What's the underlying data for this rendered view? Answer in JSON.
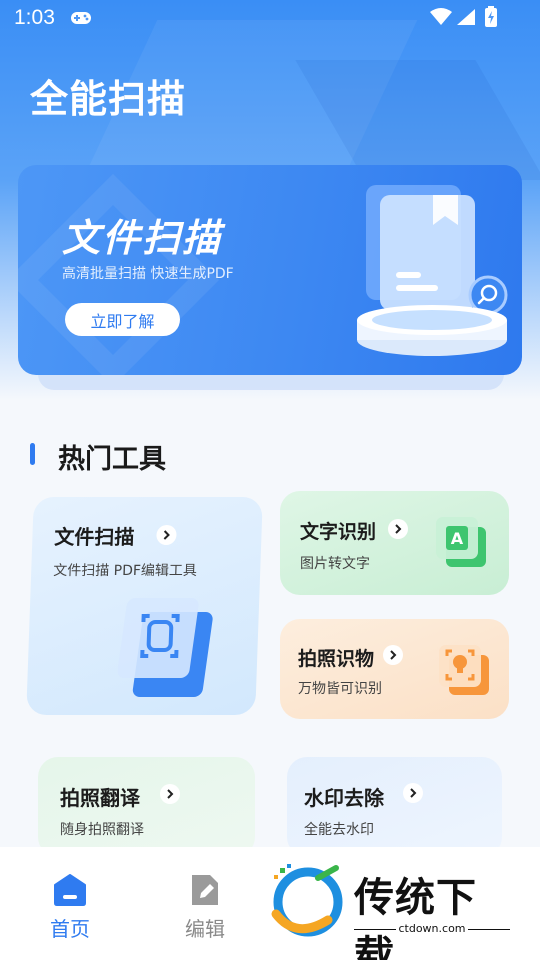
{
  "status_bar": {
    "time": "1:03"
  },
  "app": {
    "title": "全能扫描"
  },
  "banner": {
    "title": "文件扫描",
    "subtitle": "高清批量扫描 快速生成PDF",
    "button_label": "立即了解"
  },
  "section": {
    "title": "热门工具"
  },
  "tools": [
    {
      "title": "文件扫描",
      "subtitle": "文件扫描 PDF编辑工具"
    },
    {
      "title": "文字识别",
      "subtitle": "图片转文字"
    },
    {
      "title": "拍照识物",
      "subtitle": "万物皆可识别"
    },
    {
      "title": "拍照翻译",
      "subtitle": "随身拍照翻译"
    },
    {
      "title": "水印去除",
      "subtitle": "全能去水印"
    }
  ],
  "bottom_nav": [
    {
      "label": "首页",
      "active": true
    },
    {
      "label": "编辑",
      "active": false
    }
  ],
  "watermark": {
    "text": "传统下载",
    "url": "ctdown.com"
  },
  "colors": {
    "primary": "#2f7bf0",
    "ocr_green": "#3ec56f",
    "photo_orange": "#f7963b",
    "nav_inactive": "#8a8a8a"
  }
}
